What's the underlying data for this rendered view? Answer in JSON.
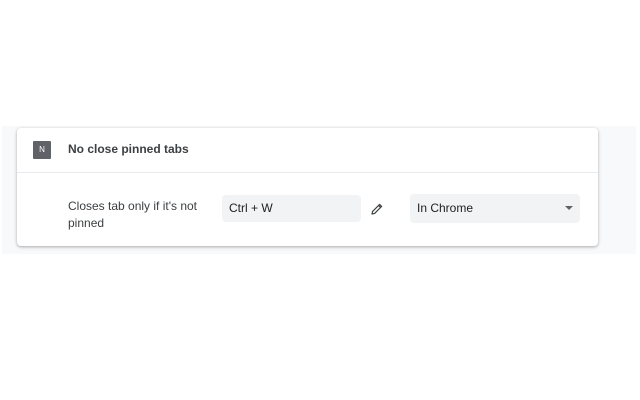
{
  "extension": {
    "icon_letter": "N",
    "name": "No close pinned tabs"
  },
  "shortcut": {
    "description": "Closes tab only if it's not pinned",
    "value": "Ctrl + W",
    "scope": "In Chrome",
    "edit_icon": "pencil-icon",
    "dropdown_icon": "chevron-down-icon"
  },
  "colors": {
    "icon_background": "#5f6368",
    "field_background": "#f1f3f4",
    "text": "#3c4043"
  }
}
